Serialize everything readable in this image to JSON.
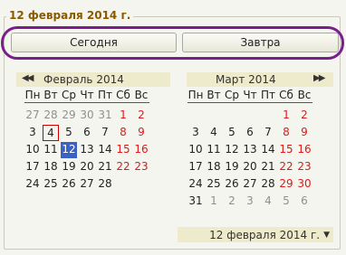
{
  "group_title": "12 февраля 2014 г.",
  "buttons": {
    "today": "Сегодня",
    "tomorrow": "Завтра"
  },
  "left_calendar": {
    "month_label": "Февраль 2014",
    "nav_prev_icon": "double-left-arrow",
    "weekdays": [
      "Пн",
      "Вт",
      "Ср",
      "Чт",
      "Пт",
      "Сб",
      "Вс"
    ],
    "weeks": [
      [
        "27",
        "28",
        "29",
        "30",
        "31",
        "1",
        "2"
      ],
      [
        "3",
        "4",
        "5",
        "6",
        "7",
        "8",
        "9"
      ],
      [
        "10",
        "11",
        "12",
        "13",
        "14",
        "15",
        "16"
      ],
      [
        "17",
        "18",
        "19",
        "20",
        "21",
        "22",
        "23"
      ],
      [
        "24",
        "25",
        "26",
        "27",
        "28",
        "",
        ""
      ]
    ]
  },
  "right_calendar": {
    "month_label": "Март 2014",
    "nav_next_icon": "double-right-arrow",
    "weekdays": [
      "Пн",
      "Вт",
      "Ср",
      "Чт",
      "Пт",
      "Сб",
      "Вс"
    ],
    "weeks": [
      [
        "",
        "",
        "",
        "",
        "",
        "1",
        "2"
      ],
      [
        "3",
        "4",
        "5",
        "6",
        "7",
        "8",
        "9"
      ],
      [
        "10",
        "11",
        "12",
        "13",
        "14",
        "15",
        "16"
      ],
      [
        "17",
        "18",
        "19",
        "20",
        "21",
        "22",
        "23"
      ],
      [
        "24",
        "25",
        "26",
        "27",
        "28",
        "29",
        "30"
      ],
      [
        "31",
        "1",
        "2",
        "3",
        "4",
        "5",
        "6"
      ]
    ]
  },
  "footer_label": "12 февраля 2014 г.",
  "colors": {
    "highlight_outline": "#7a1f8a",
    "weekend": "#dd1a1a",
    "selected_bg": "#3a62c4",
    "today_border": "#cc0000"
  }
}
